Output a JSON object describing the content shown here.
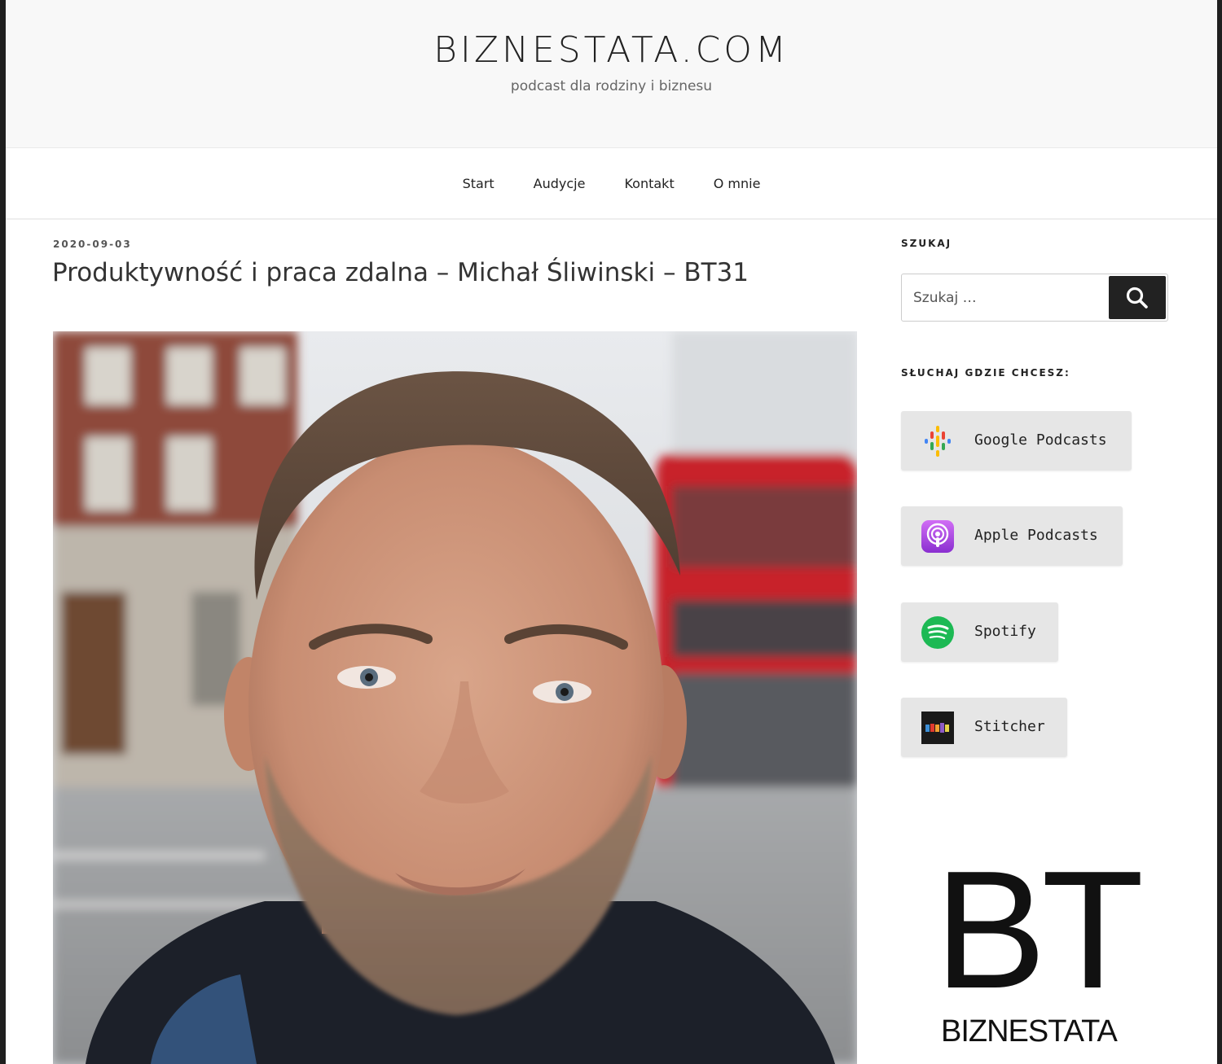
{
  "header": {
    "site_title": "BIZNESTATA.COM",
    "site_description": "podcast dla rodziny i biznesu"
  },
  "nav": {
    "items": [
      "Start",
      "Audycje",
      "Kontakt",
      "O mnie"
    ]
  },
  "post": {
    "date": "2020-09-03",
    "title": "Produktywność i praca zdalna – Michał Śliwinski – BT31"
  },
  "sidebar": {
    "search": {
      "title": "SZUKAJ",
      "placeholder": "Szukaj …"
    },
    "listen": {
      "title": "SŁUCHAJ GDZIE CHCESZ:",
      "buttons": [
        {
          "label": "Google Podcasts",
          "icon": "google-podcasts-icon"
        },
        {
          "label": "Apple Podcasts",
          "icon": "apple-podcasts-icon"
        },
        {
          "label": "Spotify",
          "icon": "spotify-icon"
        },
        {
          "label": "Stitcher",
          "icon": "stitcher-icon"
        }
      ]
    },
    "logo": {
      "letters": "BT",
      "word": "BIZNESTATA"
    }
  },
  "colors": {
    "header_bg": "#f8f8f8",
    "button_bg": "#e6e6e6",
    "search_button_bg": "#222222",
    "spotify_green": "#1db954",
    "apple_purple": "#a64ee0"
  }
}
